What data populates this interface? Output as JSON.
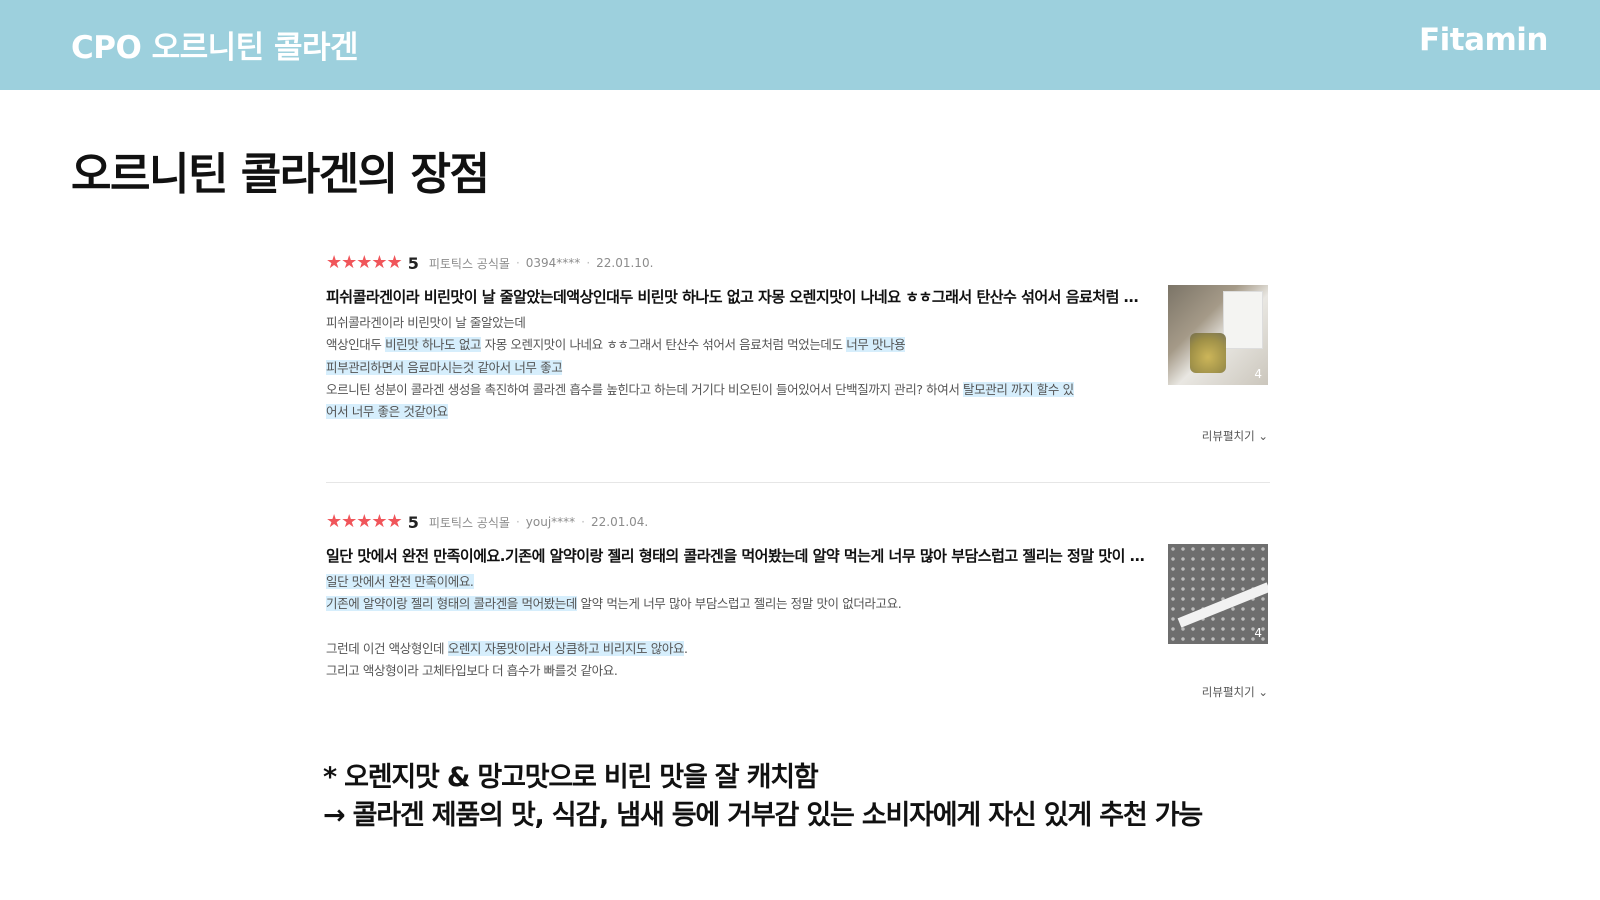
{
  "header": {
    "title": "CPO 오르니틴 콜라겐",
    "brand": "Fitamin"
  },
  "page_title": "오르니틴 콜라겐의 장점",
  "reviews": [
    {
      "stars": "★★★★★",
      "rating": 5,
      "rating_text": "5",
      "store": "피토틱스 공식몰",
      "user": "0394****",
      "date": "22.01.10.",
      "headline": "피쉬콜라겐이라 비린맛이 날 줄알았는데액상인대두 비린맛 하나도 없고 자몽 오렌지맛이 나네요 ㅎㅎ그래서 탄산수 섞어서 음료처럼 먹었는데도 너무 맛나용",
      "body": {
        "l1": "피쉬콜라겐이라 비린맛이 날 줄알았는데",
        "l2_a": "액상인대두 ",
        "l2_b": "비린맛 하나도 없고",
        "l2_c": " 자몽 오렌지맛이 나네요 ㅎㅎ그래서 탄산수 섞어서 음료처럼 먹었는데도 ",
        "l2_d": "너무 맛나용",
        "l3": "피부관리하면서 음료마시는것 같아서 너무 좋고",
        "l4_a": "오르니틴 성분이 콜라겐 생성을 촉진하여 콜라겐 흡수를 높힌다고 하는데 거기다 비오틴이 들어있어서 단백질까지 관리? 하여서 ",
        "l4_b": "탈모관리 까지 할수 있",
        "l5": "어서 너무 좋은 것같아요"
      },
      "photo_count": "4",
      "expand_label": "리뷰펼치기"
    },
    {
      "stars": "★★★★★",
      "rating": 5,
      "rating_text": "5",
      "store": "피토틱스 공식몰",
      "user": "youj****",
      "date": "22.01.04.",
      "headline": "일단 맛에서 완전 만족이에요.기존에 알약이랑 젤리 형태의 콜라겐을 먹어봤는데 알약 먹는게 너무 많아 부담스럽고 젤리는 정말 맛이 없더라고요.",
      "body": {
        "l1": "일단 맛에서 완전 만족이에요.",
        "l2_a": "기존에 알약이랑 젤리 형태의 콜라겐을 먹어봤는데",
        "l2_b": " 알약 먹는게 너무 많아 부담스럽고 젤리는 정말 맛이 없더라고요.",
        "l4_a": "그런데 이건 액상형인데 ",
        "l4_b": "오렌지 자몽맛이라서 상큼하고 비리지도 않아요",
        "l4_c": ".",
        "l5": "그리고 액상형이라 고체타입보다 더 흡수가 빠를것 같아요."
      },
      "photo_count": "4",
      "expand_label": "리뷰펼치기"
    }
  ],
  "takeaway": {
    "line1": "* 오렌지맛 & 망고맛으로 비린 맛을 잘 캐치함",
    "line2": "→ 콜라겐 제품의 맛, 식감, 냄새 등에 거부감 있는 소비자에게 자신 있게 추천 가능"
  },
  "colors": {
    "header_bg": "#9dd0dd",
    "star": "#f0555a",
    "highlight": "#d6eefc"
  }
}
